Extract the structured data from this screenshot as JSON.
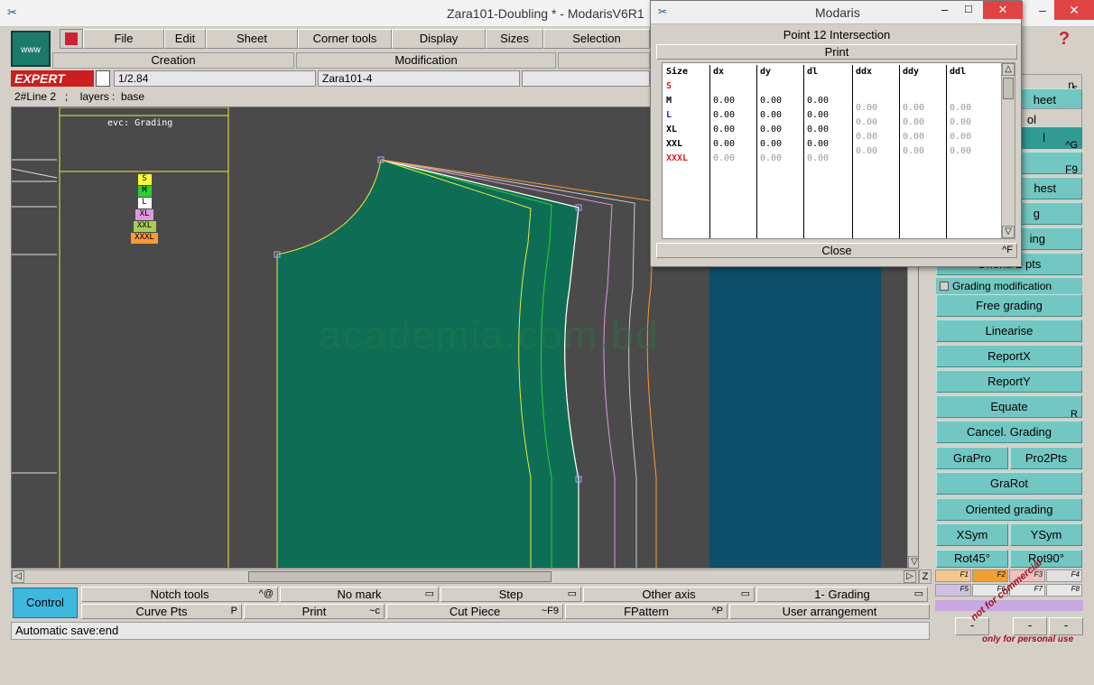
{
  "window": {
    "title": "Zara101-Doubling * - ModarisV6R1",
    "controls": [
      "–",
      "□",
      "✕"
    ]
  },
  "menu": {
    "logo_label": "www",
    "items": [
      "File",
      "Edit",
      "Sheet",
      "Corner tools",
      "Display",
      "Sizes",
      "Selection"
    ],
    "sub_creation": "Creation",
    "sub_modification": "Modification",
    "expert_label": "EXPERT",
    "scale": "1/2.84",
    "piece_name": "Zara101-4",
    "status_line": "2#Line 2   ;    layers :  base"
  },
  "workspace": {
    "legend_title": "evc: Grading",
    "legend_sizes": [
      {
        "label": "S",
        "color": "#ffff33"
      },
      {
        "label": "M",
        "color": "#33cc33"
      },
      {
        "label": "L",
        "color": "#ffffff"
      },
      {
        "label": "XL",
        "color": "#dd99dd"
      },
      {
        "label": "XXL",
        "color": "#aacc55"
      },
      {
        "label": "XXXL",
        "color": "#ff9933"
      }
    ],
    "watermark": "academia.com.bd",
    "piece_fill": "#0d6e55",
    "blue_piece_fill": "#0d4f6b"
  },
  "dialog": {
    "title": "Modaris",
    "header": "Point 12 Intersection",
    "print_label": "Print",
    "close_label": "Close",
    "close_hotkey": "^F",
    "columns": [
      "Size",
      "dx",
      "dy",
      "dl",
      "ddx",
      "ddy",
      "ddl"
    ],
    "rows": [
      {
        "size": "S",
        "color": "#dd2222",
        "dx": "",
        "dy": "",
        "dl": "",
        "ddx": "",
        "ddy": "",
        "ddl": ""
      },
      {
        "size": "M",
        "color": "#000000",
        "dx": "0.00",
        "dy": "0.00",
        "dl": "0.00",
        "ddx": "0.00",
        "ddy": "0.00",
        "ddl": "0.00"
      },
      {
        "size": "L",
        "color": "#2222cc",
        "dx": "0.00",
        "dy": "0.00",
        "dl": "0.00",
        "ddx": "0.00",
        "ddy": "0.00",
        "ddl": "0.00"
      },
      {
        "size": "XL",
        "color": "#000000",
        "dx": "0.00",
        "dy": "0.00",
        "dl": "0.00",
        "ddx": "0.00",
        "ddy": "0.00",
        "ddl": "0.00"
      },
      {
        "size": "XXL",
        "color": "#000000",
        "dx": "0.00",
        "dy": "0.00",
        "dl": "0.00",
        "ddx": "0.00",
        "ddy": "0.00",
        "ddl": "0.00"
      },
      {
        "size": "XXXL",
        "color": "#dd2222",
        "dx": "0.00",
        "dy": "0.00",
        "dl": "0.00",
        "ddx": "",
        "ddy": "",
        "ddl": ""
      }
    ]
  },
  "right_panel": {
    "partial_labels": [
      "n",
      "s",
      "heet",
      "ol",
      "l",
      "^G",
      "F9",
      "hest",
      "g",
      "ing",
      "Orient. 2 pts"
    ],
    "checkbox_label": "Grading modification",
    "buttons": [
      "Free grading",
      "Linearise",
      "ReportX",
      "ReportY",
      "Equate",
      "Cancel. Grading",
      "GraPro",
      "Pro2Pts",
      "GraRot",
      "Oriented grading",
      "XSym",
      "YSym",
      "Rot45°",
      "Rot90°"
    ],
    "equate_hotkey": "R",
    "func_keys": [
      "F1",
      "F2",
      "F3",
      "F4",
      "F5",
      "F6",
      "F7",
      "F8"
    ]
  },
  "bottom": {
    "control_label": "Control",
    "row1": [
      {
        "label": "Notch tools",
        "hot": "^@"
      },
      {
        "label": "No mark",
        "hot": "▭"
      },
      {
        "label": "Step",
        "hot": "▭"
      },
      {
        "label": "Other axis",
        "hot": "▭"
      },
      {
        "label": "1- Grading",
        "hot": "▭"
      }
    ],
    "row2": [
      {
        "label": "Curve Pts",
        "hot": "P"
      },
      {
        "label": "Print",
        "hot": "~c"
      },
      {
        "label": "Cut Piece",
        "hot": "~F9"
      },
      {
        "label": "FPattern",
        "hot": "^P"
      },
      {
        "label": "User arrangement",
        "hot": ""
      }
    ],
    "status": "Automatic save:end",
    "overlay_lines": [
      "not for commercial",
      "only for personal use"
    ]
  }
}
